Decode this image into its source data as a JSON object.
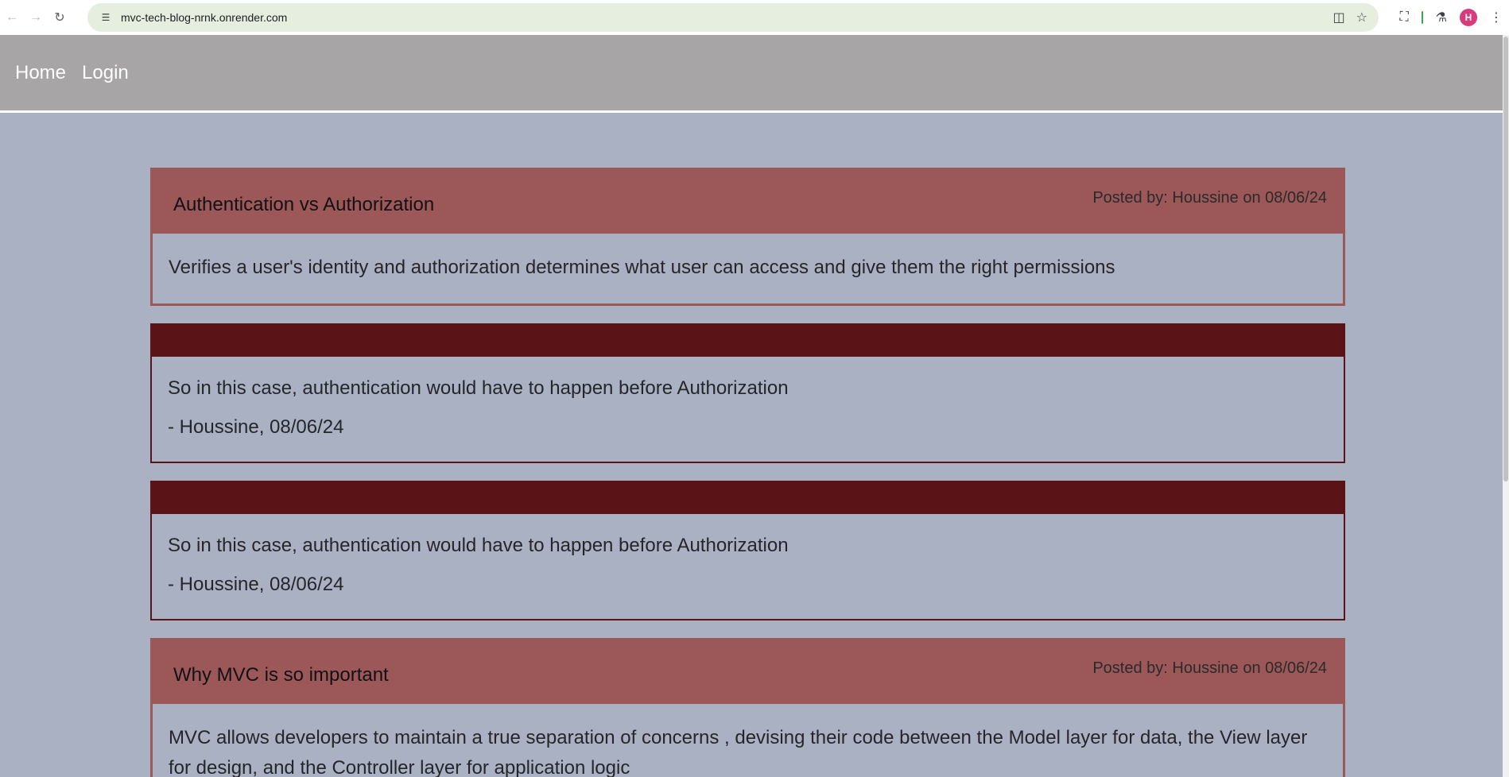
{
  "browser": {
    "url": "mvc-tech-blog-nrnk.onrender.com",
    "profile_initial": "H"
  },
  "site_nav": {
    "links": [
      {
        "label": "Home"
      },
      {
        "label": "Login"
      }
    ]
  },
  "posts": [
    {
      "title": "Authentication vs Authorization",
      "meta": "Posted by: Houssine on 08/06/24",
      "body": "Verifies a user's identity and authorization determines what user can access and give them the right permissions"
    },
    {
      "title": "Why MVC is so important",
      "meta": "Posted by: Houssine on 08/06/24",
      "body": "MVC allows developers to maintain a true separation of concerns , devising their code between the Model layer for data, the View layer for design, and the Controller layer for application logic"
    }
  ],
  "comments": [
    {
      "text": "So in this case, authentication would have to happen before Authorization",
      "author_line": "- Houssine, 08/06/24"
    },
    {
      "text": "So in this case, authentication would have to happen before Authorization",
      "author_line": "- Houssine, 08/06/24"
    }
  ],
  "colors": {
    "page_bg": "#aab1c2",
    "nav_bg": "#a7a5a6",
    "post_header": "#9c5858",
    "comment_header": "#5a1417"
  }
}
